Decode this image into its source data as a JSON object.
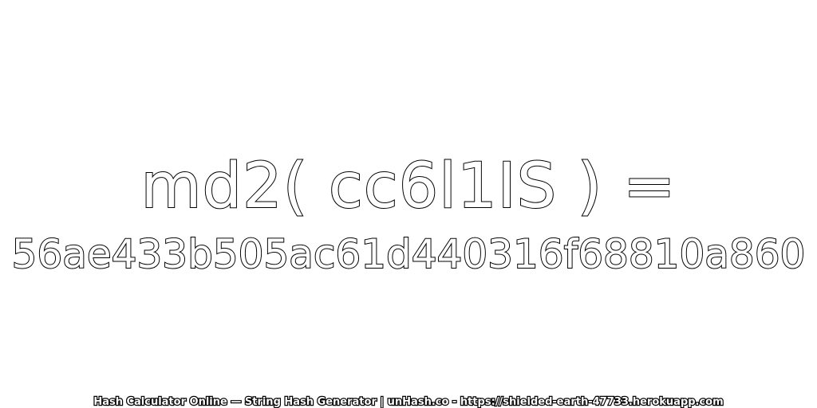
{
  "expression": "md2( cc6l1IS ) =",
  "hash_value": "56ae433b505ac61d440316f68810a860",
  "footer": "Hash Calculator Online — String Hash Generator | unHash.co - https://shielded-earth-47733.herokuapp.com",
  "colors": {
    "background": "#ffffff",
    "text_fill": "#ffffff",
    "text_outline": "#000000"
  }
}
